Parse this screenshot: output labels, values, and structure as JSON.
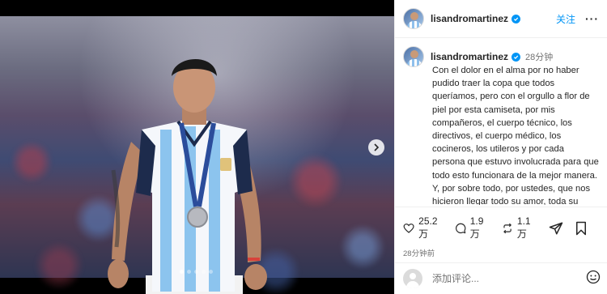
{
  "post": {
    "username": "lisandromartinez",
    "follow_label": "关注",
    "more_label": "···",
    "caption_time": "28分钟",
    "caption": "Con el dolor en el alma por no haber pudido traer la copa que todos queríamos, pero con el orgullo a flor de piel por esta camiseta, por mis compañeros, el cuerpo técnico, los directivos, el cuerpo médico, los cocineros, los utileros y por cada persona que estuvo involucrada para que todo esto funcionara de la mejor manera. Y, por sobre todo, por ustedes, que nos hicieron llegar todo su amor, toda su fuerza, esa pasión que tanto nos caracteriza y la unión.",
    "post_time": "28分钟前"
  },
  "stats": {
    "likes": "25.2 万",
    "comments": "1.9 万",
    "reposts": "1.1 万"
  },
  "comment_box": {
    "placeholder": "添加评论..."
  },
  "media": {
    "slide_count": 5,
    "active_slide": 0
  },
  "icons": {
    "verified": "verified-badge-icon",
    "like": "heart-icon",
    "comment": "comment-bubble-icon",
    "repost": "repost-icon",
    "share": "share-plane-icon",
    "save": "bookmark-icon",
    "emoji": "emoji-icon",
    "next": "chevron-right-icon"
  },
  "colors": {
    "accent": "#0095f6",
    "muted": "#737373",
    "text": "#262626"
  }
}
